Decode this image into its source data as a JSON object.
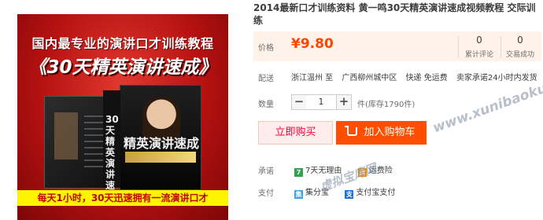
{
  "product": {
    "image": {
      "top_text": "国内最专业的演讲口才训练教程",
      "title_text": "《30天精英演讲速成》",
      "box_big_text": "精英演讲速成",
      "spine_text": "30天精英演讲速成",
      "bottom_text": "每天1小时，30天迅速拥有一流演讲口才",
      "colors": {
        "background": "#b51111",
        "bottom_band": "#fff300"
      }
    },
    "title": "2014最新口才训练资料 黄一鸣30天精英演讲速成视频教程 交际训练"
  },
  "price": {
    "label": "价格",
    "value": "¥9.80",
    "color": "#ff4400",
    "stats": [
      {
        "num": "0",
        "label": "累计评论"
      },
      {
        "num": "0",
        "label": "交易成功"
      }
    ]
  },
  "shipping": {
    "label": "配送",
    "from": "浙江温州 至",
    "to": "广西柳州城中区",
    "method": "快递 免运费",
    "promise": "卖家承诺24小时内发货"
  },
  "quantity": {
    "label": "数量",
    "minus": "−",
    "value": "1",
    "plus": "+",
    "stock": "件(库存1790件)"
  },
  "actions": {
    "buy_now": "立即购买",
    "add_to_cart": "加入购物车"
  },
  "commitment": {
    "label": "承诺",
    "items": [
      {
        "icon": "seven-days-icon",
        "badge": "7",
        "text": "7天无理由",
        "color": "#2fa34e"
      },
      {
        "icon": "shipping-guarantee-icon",
        "badge": "运",
        "text": "运费险",
        "color": "#f08a00"
      }
    ]
  },
  "payment": {
    "label": "支付",
    "items": [
      {
        "icon": "jifenbao-icon",
        "badge": "集",
        "text": "集分宝",
        "color": "#3da3e8"
      },
      {
        "icon": "alipay-icon",
        "badge": "支",
        "text": "支付宝支付",
        "color": "#1e6fd6"
      }
    ]
  },
  "watermarks": [
    "www.xunibaoku.com",
    "虚拟宝库网"
  ]
}
